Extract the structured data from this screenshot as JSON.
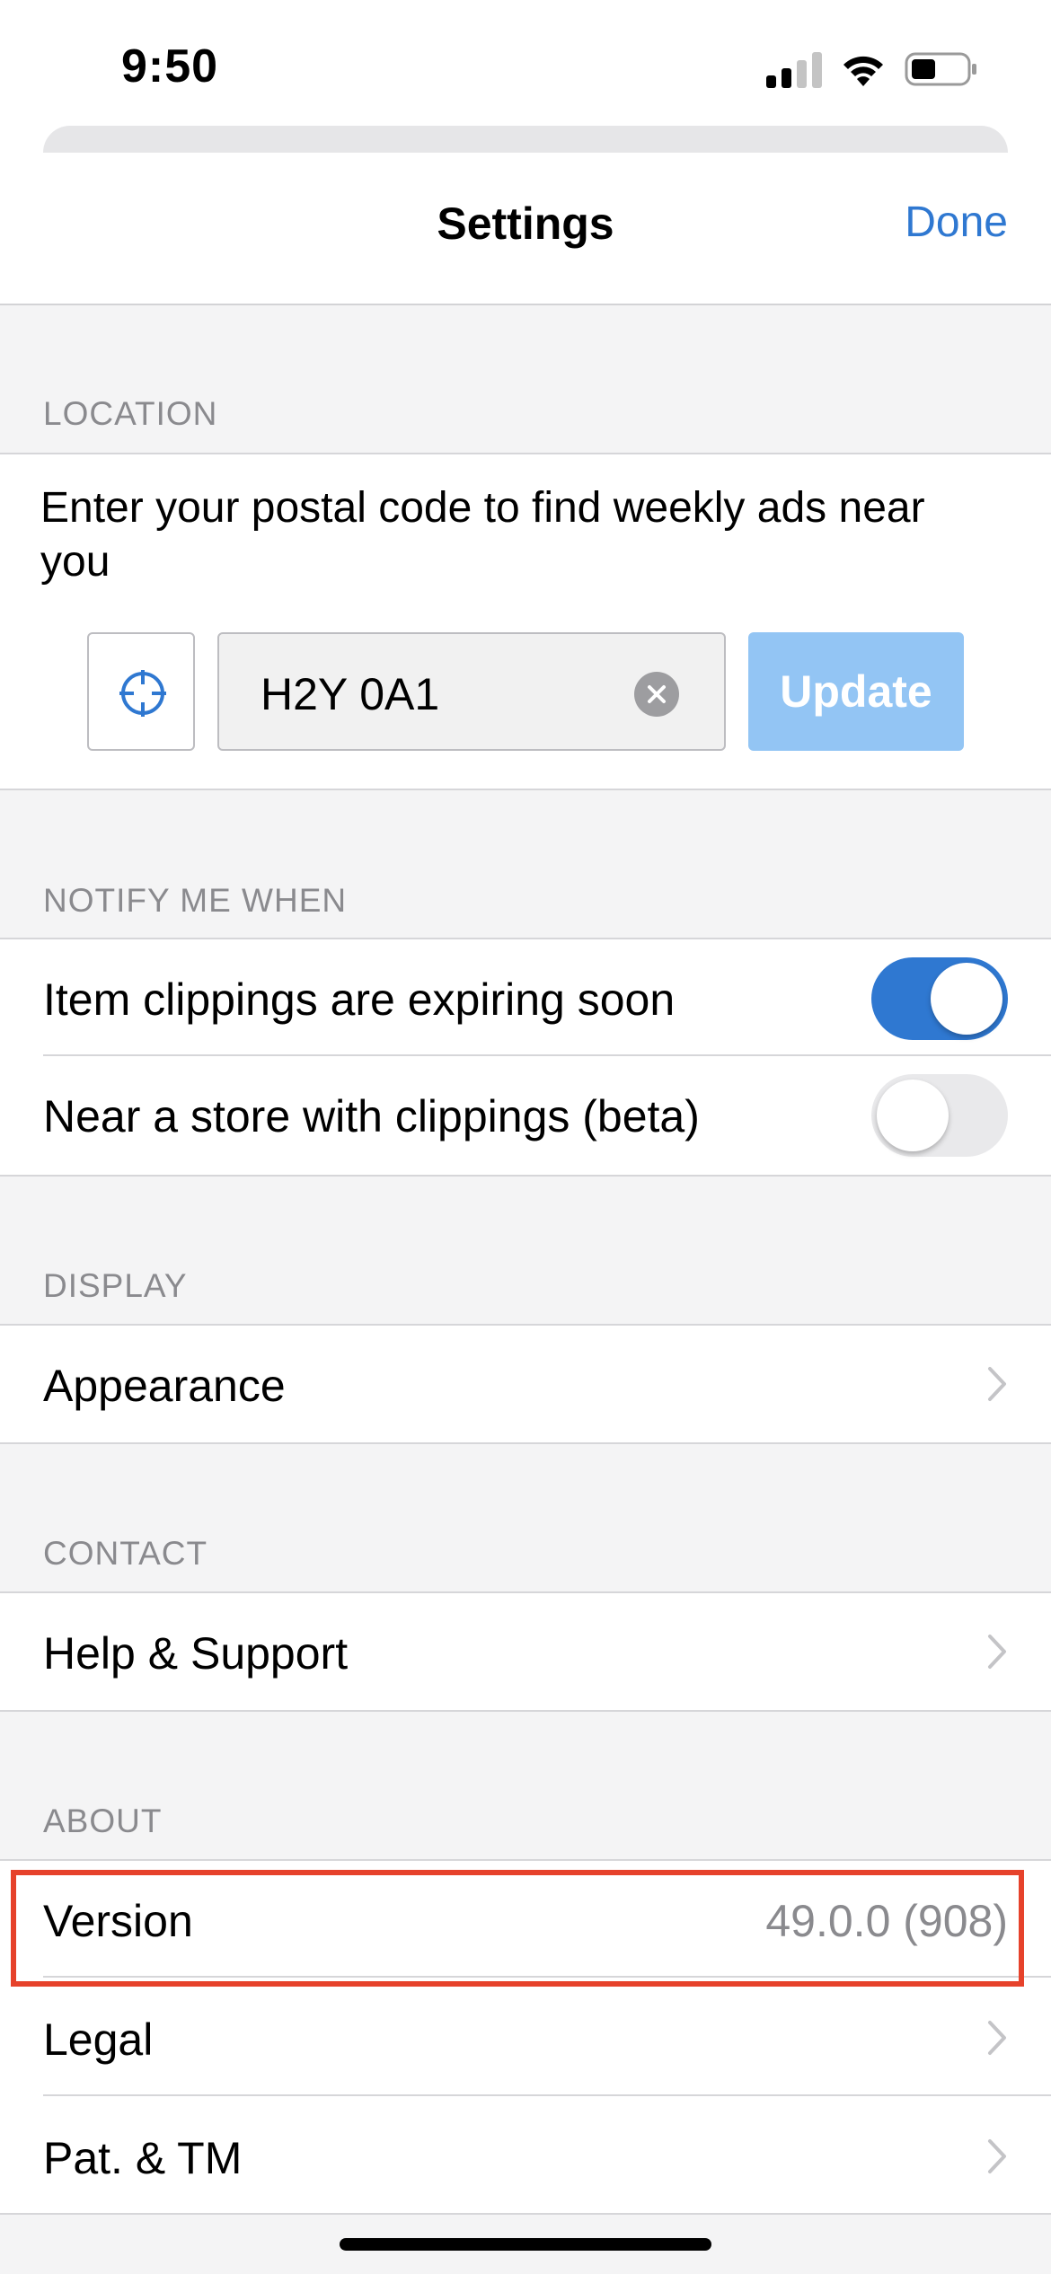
{
  "status_bar": {
    "time": "9:50"
  },
  "header": {
    "title": "Settings",
    "done_label": "Done"
  },
  "location": {
    "section_label": "LOCATION",
    "description": "Enter your postal code to find weekly ads near you",
    "postal_code": "H2Y 0A1",
    "update_label": "Update"
  },
  "notify": {
    "section_label": "NOTIFY ME WHEN",
    "items": [
      {
        "label": "Item clippings are expiring soon",
        "enabled": true
      },
      {
        "label": "Near a store with clippings (beta)",
        "enabled": false
      }
    ]
  },
  "display": {
    "section_label": "DISPLAY",
    "appearance_label": "Appearance"
  },
  "contact": {
    "section_label": "CONTACT",
    "help_label": "Help & Support"
  },
  "about": {
    "section_label": "ABOUT",
    "version_label": "Version",
    "version_value": "49.0.0 (908)",
    "legal_label": "Legal",
    "pat_tm_label": "Pat. & TM"
  },
  "colors": {
    "accent": "#2f78d1",
    "update_button": "#93c5f4",
    "highlight_box": "#e6422b",
    "grouped_background": "#f4f4f5"
  }
}
